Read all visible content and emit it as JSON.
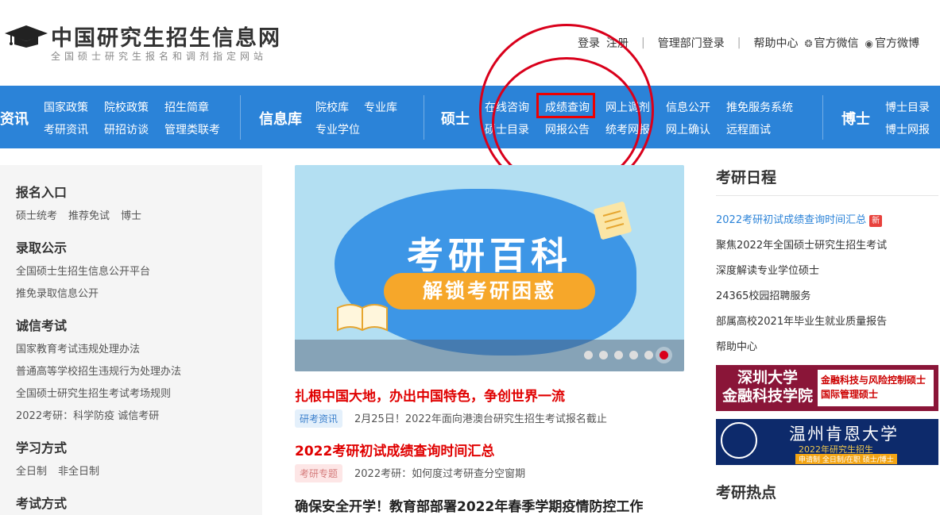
{
  "header": {
    "title": "中国研究生招生信息网",
    "subtitle": "全国硕士研究生报名和调剂指定网站",
    "links": {
      "login": "登录",
      "register": "注册",
      "admin_login": "管理部门登录",
      "help": "帮助中心",
      "wechat": "官方微信",
      "weibo": "官方微博"
    }
  },
  "nav": {
    "groups": {
      "news": "资讯",
      "library": "信息库",
      "master": "硕士",
      "doctor": "博士"
    },
    "items": {
      "national_policy": "国家政策",
      "school_policy": "院校政策",
      "brochure": "招生简章",
      "exam_news": "考研资讯",
      "interviews": "研招访谈",
      "mgmt_exam": "管理类联考",
      "school_lib": "院校库",
      "major_lib": "专业库",
      "prof_degree": "专业学位",
      "online_consult": "在线咨询",
      "score_query": "成绩查询",
      "online_adjust": "网上调剂",
      "info_public": "信息公开",
      "recommend": "推免服务系统",
      "master_catalog": "硕士目录",
      "reg_notice": "网报公告",
      "unified_reg": "统考网报",
      "online_confirm": "网上确认",
      "remote_interview": "远程面试",
      "doctor_catalog": "博士目录",
      "doctor_reg": "博士网报"
    }
  },
  "sidebar": {
    "sections": [
      {
        "title": "报名入口",
        "items": [
          "硕士统考",
          "推荐免试",
          "博士"
        ]
      },
      {
        "title": "录取公示",
        "items": [
          "全国硕士生招生信息公开平台",
          "推免录取信息公开"
        ]
      },
      {
        "title": "诚信考试",
        "items": [
          "国家教育考试违规处理办法",
          "普通高等学校招生违规行为处理办法",
          "全国硕士研究生招生考试考场规则",
          "2022考研：科学防疫 诚信考研"
        ]
      },
      {
        "title": "学习方式",
        "items": [
          "全日制",
          "非全日制"
        ]
      },
      {
        "title": "考试方式",
        "items": []
      }
    ]
  },
  "banner": {
    "title": "考研百科",
    "pill": "解锁考研困惑"
  },
  "news": {
    "headline1": "扎根中国大地，办出中国特色，争创世界一流",
    "tag1": "研考资讯",
    "sub1": "2月25日！2022年面向港澳台研究生招生考试报名截止",
    "headline2": "2022考研初试成绩查询时间汇总",
    "tag2": "考研专题",
    "sub2": "2022考研：如何度过考研查分空窗期",
    "headline3": "确保安全开学！教育部部署2022年春季学期疫情防控工作"
  },
  "right": {
    "calendar_title": "考研日程",
    "calendar_items": [
      "2022考研初试成绩查询时间汇总",
      "聚焦2022年全国硕士研究生招生考试",
      "深度解读专业学位硕士",
      "24365校园招聘服务",
      "部属高校2021年毕业生就业质量报告",
      "帮助中心"
    ],
    "new_badge": "新",
    "ad1_left": "深圳大学\n金融科技学院",
    "ad1_right": "金融科技与风险控制硕士 国际管理硕士",
    "ad2_title": "温州肯恩大学",
    "ad2_sub": "2022年研究生招生",
    "ad2_foot": "申请制 全日制/在职 硕士/博士",
    "hot_title": "考研热点"
  },
  "colors": {
    "nav_bg": "#2b83d8",
    "accent_red": "#e00000",
    "annotation_red": "#d9001b"
  }
}
